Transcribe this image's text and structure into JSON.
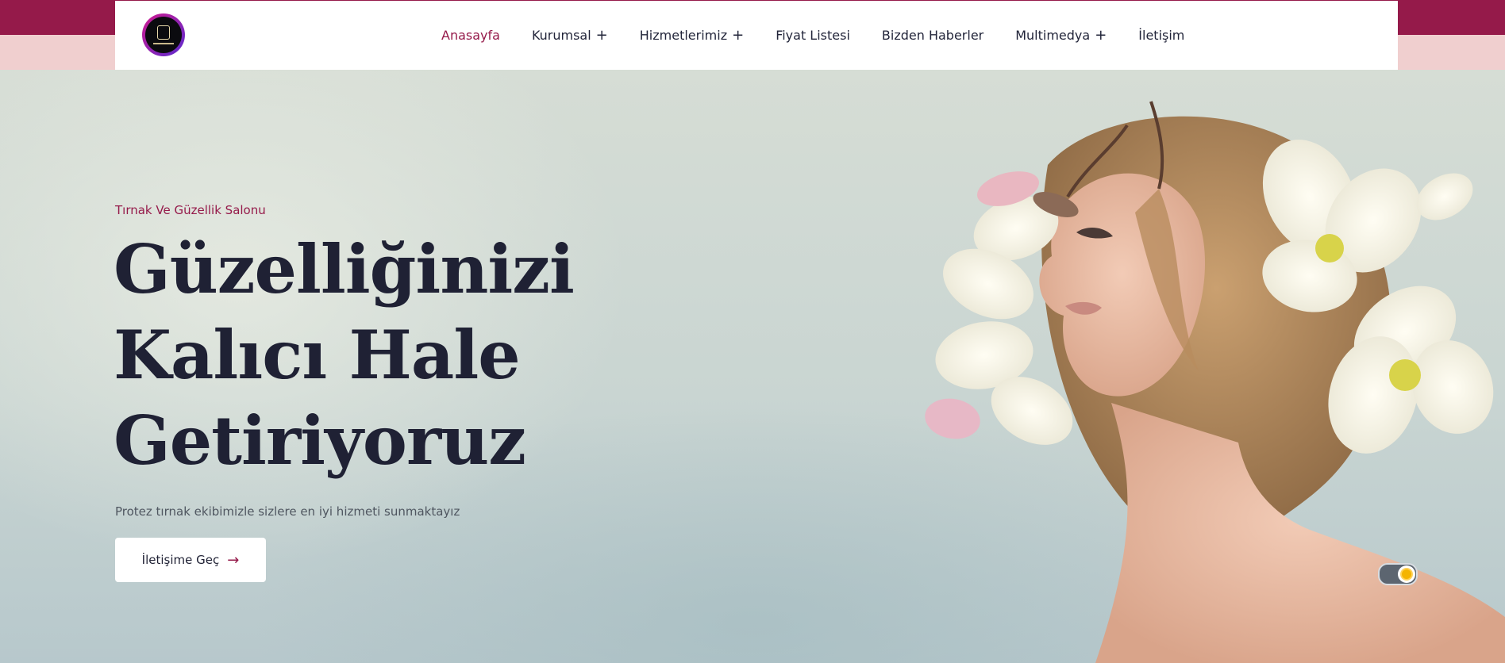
{
  "nav": {
    "items": [
      {
        "label": "Anasayfa",
        "has_submenu": false,
        "active": true
      },
      {
        "label": "Kurumsal",
        "has_submenu": true,
        "active": false
      },
      {
        "label": "Hizmetlerimiz",
        "has_submenu": true,
        "active": false
      },
      {
        "label": "Fiyat Listesi",
        "has_submenu": false,
        "active": false
      },
      {
        "label": "Bizden Haberler",
        "has_submenu": false,
        "active": false
      },
      {
        "label": "Multimedya",
        "has_submenu": true,
        "active": false
      },
      {
        "label": "İletişim",
        "has_submenu": false,
        "active": false
      }
    ],
    "submenu_icon": "+"
  },
  "hero": {
    "eyebrow": "Tırnak Ve Güzellik Salonu",
    "headline": [
      "Güzelliğinizi",
      "Kalıcı Hale",
      "Getiriyoruz"
    ],
    "subtext": "Protez tırnak ekibimizle sizlere en iyi hizmeti sunmaktayız",
    "cta_label": "İletişime Geç",
    "cta_icon": "arrow-right-icon"
  },
  "theme_toggle": {
    "icon": "sun-icon",
    "state": "light"
  },
  "colors": {
    "accent": "#951a4a",
    "top_band_light": "#f0cfcf",
    "heading": "#1f2134",
    "text": "#4f5660"
  }
}
